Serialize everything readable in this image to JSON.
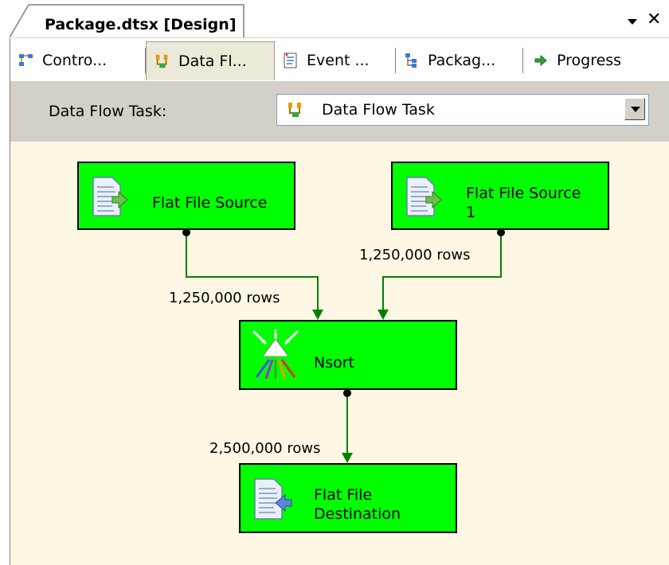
{
  "document_tab": {
    "title": "Package.dtsx [Design]"
  },
  "designer_tabs": [
    {
      "label": "Contro...",
      "icon": "control-flow-icon"
    },
    {
      "label": "Data Fl...",
      "icon": "data-flow-icon",
      "active": true
    },
    {
      "label": "Event ...",
      "icon": "event-handlers-icon"
    },
    {
      "label": "Packag...",
      "icon": "package-explorer-icon"
    },
    {
      "label": "Progress",
      "icon": "progress-arrow-icon"
    }
  ],
  "task_selector": {
    "label": "Data Flow Task:",
    "value": "Data Flow Task"
  },
  "components": {
    "source1": {
      "label": "Flat File Source"
    },
    "source2": {
      "label_line1": "Flat File Source",
      "label_line2": "1"
    },
    "nsort": {
      "label": "Nsort"
    },
    "destination": {
      "label_line1": "Flat File",
      "label_line2": "Destination"
    }
  },
  "paths": {
    "source1_to_nsort": "1,250,000 rows",
    "source2_to_nsort": "1,250,000 rows",
    "nsort_to_destination": "2,500,000 rows"
  },
  "colors": {
    "component_fill": "#00ff00",
    "connector": "#008000",
    "surface": "#fdf7e4"
  }
}
